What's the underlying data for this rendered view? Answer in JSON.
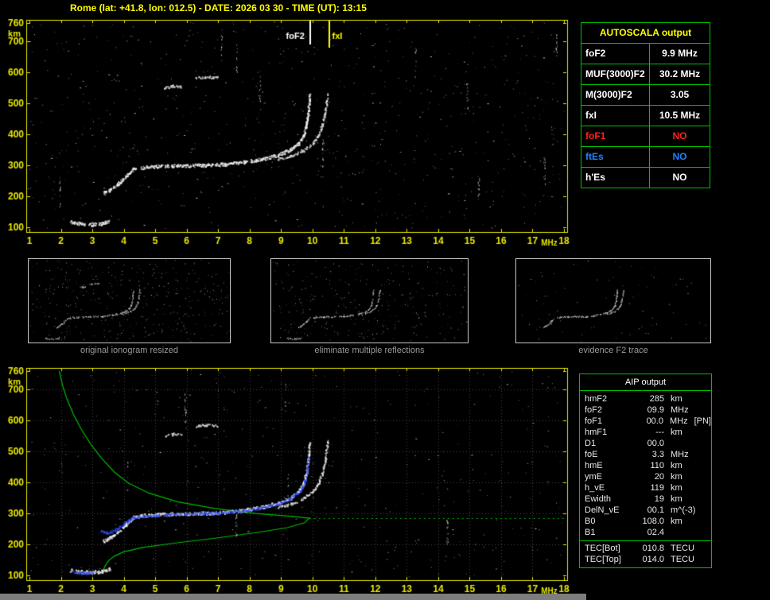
{
  "title": "Rome (lat: +41.8, lon: 012.5) - DATE: 2026 03 30 - TIME (UT): 13:15",
  "colors": {
    "background": "#000000",
    "title_yellow": "#ffff00",
    "axis_yellow": "#e8e800",
    "border_green": "#00c000",
    "trace_white": "#f0f0f0",
    "fitted_blue": "#3050ff",
    "profile_green": "#00bb00",
    "foF1_red": "#ff2020",
    "ftEs_blue": "#2080ff",
    "caption_gray": "#9a9a9a"
  },
  "autoscala": {
    "header": "AUTOSCALA output",
    "rows": [
      {
        "label": "foF2",
        "value": "9.9 MHz"
      },
      {
        "label": "MUF(3000)F2",
        "value": "30.2 MHz"
      },
      {
        "label": "M(3000)F2",
        "value": "3.05"
      },
      {
        "label": "fxI",
        "value": "10.5 MHz"
      },
      {
        "label": "foF1",
        "value": "NO"
      },
      {
        "label": "ftEs",
        "value": "NO"
      },
      {
        "label": "h'Es",
        "value": "NO"
      }
    ]
  },
  "thumbnails": [
    {
      "caption": "original ionogram resized"
    },
    {
      "caption": "eliminate multiple reflections"
    },
    {
      "caption": "evidence F2 trace"
    }
  ],
  "aip": {
    "header": "AIP output",
    "rows": [
      {
        "name": "hmF2",
        "value": "285",
        "unit": "km"
      },
      {
        "name": "foF2",
        "value": "09.9",
        "unit": "MHz"
      },
      {
        "name": "foF1",
        "value": "00.0",
        "unit": "MHz",
        "extra": "[PN]"
      },
      {
        "name": "hmF1",
        "value": "---",
        "unit": "km"
      },
      {
        "name": "D1",
        "value": "00.0",
        "unit": ""
      },
      {
        "name": "foE",
        "value": "3.3",
        "unit": "MHz"
      },
      {
        "name": "hmE",
        "value": "110",
        "unit": "km"
      },
      {
        "name": "ymE",
        "value": "20",
        "unit": "km"
      },
      {
        "name": "h_vE",
        "value": "119",
        "unit": "km"
      },
      {
        "name": "Ewidth",
        "value": "19",
        "unit": "km"
      },
      {
        "name": "DelN_vE",
        "value": "00.1",
        "unit": "m^(-3)"
      },
      {
        "name": "B0",
        "value": "108.0",
        "unit": "km"
      },
      {
        "name": "B1",
        "value": "02.4",
        "unit": ""
      }
    ],
    "tec_rows": [
      {
        "name": "TEC[Bot]",
        "value": "010.8",
        "unit": "TECU"
      },
      {
        "name": "TEC[Top]",
        "value": "014.0",
        "unit": "TECU"
      }
    ]
  },
  "chart_data": {
    "type": "scatter",
    "title": "Ionogram with Autoscala interpretation (top: scaled ionogram, bottom: ionogram with fitted trace and electron density profile)",
    "x_axis": {
      "label": "MHz",
      "min": 1,
      "max": 18,
      "ticks": [
        1,
        2,
        3,
        4,
        5,
        6,
        7,
        8,
        9,
        10,
        11,
        12,
        13,
        14,
        15,
        16,
        17,
        18
      ]
    },
    "y_axis": {
      "label": "km",
      "min": 100,
      "max": 760,
      "ticks": [
        100,
        200,
        300,
        400,
        500,
        600,
        700,
        760
      ]
    },
    "grid": {
      "bottom_plot_only": true,
      "x_step_mhz": 1,
      "y_step_km": 100
    },
    "markers": [
      {
        "label": "foF2",
        "freq_mhz": 9.9,
        "color": "#ffffff"
      },
      {
        "label": "fxI",
        "freq_mhz": 10.5,
        "color": "#ffff00"
      }
    ],
    "traces": {
      "units": "[frequency MHz, virtual/real height km]",
      "e_layer": [
        [
          2.3,
          118
        ],
        [
          2.6,
          113
        ],
        [
          3.0,
          111
        ],
        [
          3.3,
          114
        ],
        [
          3.55,
          122
        ]
      ],
      "f2_ordinary": [
        [
          3.35,
          212
        ],
        [
          3.55,
          222
        ],
        [
          3.8,
          240
        ],
        [
          4.05,
          265
        ],
        [
          4.3,
          290
        ],
        [
          4.8,
          297
        ],
        [
          5.5,
          300
        ],
        [
          6.5,
          302
        ],
        [
          7.2,
          305
        ],
        [
          7.8,
          312
        ],
        [
          8.4,
          322
        ],
        [
          8.9,
          335
        ],
        [
          9.3,
          352
        ],
        [
          9.55,
          372
        ],
        [
          9.7,
          396
        ],
        [
          9.8,
          432
        ],
        [
          9.86,
          480
        ],
        [
          9.9,
          530
        ]
      ],
      "f2_extraordinary": [
        [
          8.9,
          322
        ],
        [
          9.3,
          332
        ],
        [
          9.7,
          350
        ],
        [
          10.0,
          372
        ],
        [
          10.18,
          398
        ],
        [
          10.3,
          432
        ],
        [
          10.4,
          478
        ],
        [
          10.47,
          535
        ]
      ],
      "multiple_1": [
        [
          5.3,
          552
        ],
        [
          5.55,
          558
        ],
        [
          5.8,
          556
        ]
      ],
      "multiple_2": [
        [
          6.25,
          582
        ],
        [
          6.6,
          588
        ],
        [
          6.95,
          585
        ]
      ],
      "fitted": [
        [
          3.2,
          252
        ],
        [
          3.45,
          238
        ],
        [
          3.7,
          246
        ],
        [
          4.0,
          268
        ],
        [
          4.3,
          289
        ],
        [
          5.0,
          296
        ],
        [
          6.0,
          300
        ],
        [
          7.0,
          303
        ],
        [
          7.8,
          310
        ],
        [
          8.4,
          320
        ],
        [
          8.9,
          333
        ],
        [
          9.3,
          350
        ],
        [
          9.6,
          374
        ],
        [
          9.75,
          402
        ],
        [
          9.84,
          448
        ],
        [
          9.88,
          490
        ]
      ],
      "fitted_e": [
        [
          2.3,
          113
        ],
        [
          2.65,
          109
        ],
        [
          3.0,
          112
        ]
      ],
      "profile": [
        [
          1.95,
          760
        ],
        [
          2.05,
          715
        ],
        [
          2.2,
          668
        ],
        [
          2.4,
          620
        ],
        [
          2.65,
          572
        ],
        [
          2.95,
          524
        ],
        [
          3.3,
          478
        ],
        [
          3.7,
          434
        ],
        [
          4.15,
          398
        ],
        [
          4.8,
          366
        ],
        [
          5.7,
          338
        ],
        [
          6.9,
          316
        ],
        [
          8.2,
          300
        ],
        [
          9.3,
          291
        ],
        [
          9.8,
          286
        ],
        [
          9.9,
          285
        ],
        [
          9.75,
          270
        ],
        [
          9.2,
          254
        ],
        [
          8.2,
          238
        ],
        [
          6.9,
          220
        ],
        [
          5.6,
          204
        ],
        [
          4.6,
          190
        ],
        [
          4.0,
          176
        ],
        [
          3.7,
          162
        ],
        [
          3.52,
          148
        ],
        [
          3.42,
          133
        ],
        [
          3.36,
          120
        ],
        [
          3.3,
          111
        ],
        [
          3.26,
          105
        ]
      ],
      "hmf2_line": {
        "height_km": 285,
        "f_start_mhz": 9.9,
        "f_end_mhz": 18
      }
    }
  }
}
